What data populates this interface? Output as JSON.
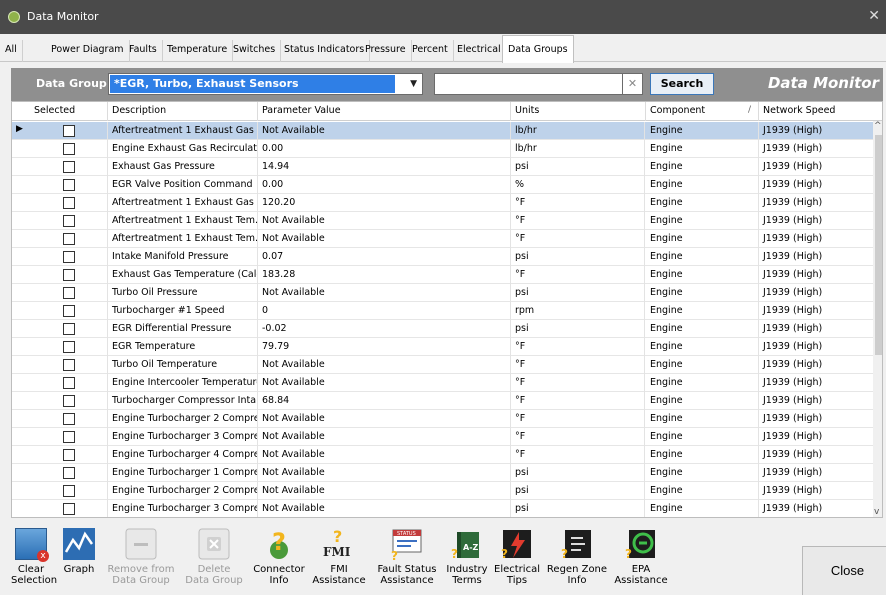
{
  "window": {
    "title": "Data Monitor",
    "close_glyph": "✕"
  },
  "tabs": [
    "All",
    "Power Diagram",
    "Faults",
    "Temperature",
    "Switches",
    "Status Indicators",
    "Pressure",
    "Percent",
    "Electrical",
    "Data Groups"
  ],
  "active_tab": "Data Groups",
  "filter": {
    "label": "Data Group",
    "selected": "*EGR, Turbo, Exhaust Sensors",
    "search_value": "",
    "clear_glyph": "✕",
    "search_label": "Search",
    "brand": "Data Monitor"
  },
  "grid": {
    "headers": [
      "Selected",
      "Description",
      "Parameter Value",
      "Units",
      "Component",
      "Network Speed"
    ],
    "sort_glyph": "/",
    "rows": [
      {
        "desc": "Aftertreatment 1 Exhaust Gas ...",
        "value": "Not Available",
        "units": "lb/hr",
        "comp": "Engine",
        "net": "J1939 (High)"
      },
      {
        "desc": "Engine Exhaust Gas Recirculati...",
        "value": "0.00",
        "units": "lb/hr",
        "comp": "Engine",
        "net": "J1939 (High)"
      },
      {
        "desc": "Exhaust Gas Pressure",
        "value": "14.94",
        "units": "psi",
        "comp": "Engine",
        "net": "J1939 (High)"
      },
      {
        "desc": "EGR Valve Position Command",
        "value": "0.00",
        "units": "%",
        "comp": "Engine",
        "net": "J1939 (High)"
      },
      {
        "desc": "Aftertreatment 1 Exhaust Gas ...",
        "value": "120.20",
        "units": "°F",
        "comp": "Engine",
        "net": "J1939 (High)"
      },
      {
        "desc": "Aftertreatment 1 Exhaust Tem...",
        "value": "Not Available",
        "units": "°F",
        "comp": "Engine",
        "net": "J1939 (High)"
      },
      {
        "desc": "Aftertreatment 1 Exhaust Tem...",
        "value": "Not Available",
        "units": "°F",
        "comp": "Engine",
        "net": "J1939 (High)"
      },
      {
        "desc": "Intake Manifold Pressure",
        "value": "0.07",
        "units": "psi",
        "comp": "Engine",
        "net": "J1939 (High)"
      },
      {
        "desc": "Exhaust Gas Temperature (Calc...",
        "value": "183.28",
        "units": "°F",
        "comp": "Engine",
        "net": "J1939 (High)"
      },
      {
        "desc": "Turbo Oil Pressure",
        "value": "Not Available",
        "units": "psi",
        "comp": "Engine",
        "net": "J1939 (High)"
      },
      {
        "desc": "Turbocharger #1 Speed",
        "value": "0",
        "units": "rpm",
        "comp": "Engine",
        "net": "J1939 (High)"
      },
      {
        "desc": "EGR Differential Pressure",
        "value": "-0.02",
        "units": "psi",
        "comp": "Engine",
        "net": "J1939 (High)"
      },
      {
        "desc": "EGR Temperature",
        "value": "79.79",
        "units": "°F",
        "comp": "Engine",
        "net": "J1939 (High)"
      },
      {
        "desc": "Turbo Oil Temperature",
        "value": "Not Available",
        "units": "°F",
        "comp": "Engine",
        "net": "J1939 (High)"
      },
      {
        "desc": "Engine Intercooler Temperature",
        "value": "Not Available",
        "units": "°F",
        "comp": "Engine",
        "net": "J1939 (High)"
      },
      {
        "desc": "Turbocharger Compressor Inta...",
        "value": "68.84",
        "units": "°F",
        "comp": "Engine",
        "net": "J1939 (High)"
      },
      {
        "desc": "Engine Turbocharger 2 Compre...",
        "value": "Not Available",
        "units": "°F",
        "comp": "Engine",
        "net": "J1939 (High)"
      },
      {
        "desc": "Engine Turbocharger 3 Compre...",
        "value": "Not Available",
        "units": "°F",
        "comp": "Engine",
        "net": "J1939 (High)"
      },
      {
        "desc": "Engine Turbocharger 4 Compre...",
        "value": "Not Available",
        "units": "°F",
        "comp": "Engine",
        "net": "J1939 (High)"
      },
      {
        "desc": "Engine Turbocharger 1 Compre...",
        "value": "Not Available",
        "units": "psi",
        "comp": "Engine",
        "net": "J1939 (High)"
      },
      {
        "desc": "Engine Turbocharger 2 Compre...",
        "value": "Not Available",
        "units": "psi",
        "comp": "Engine",
        "net": "J1939 (High)"
      },
      {
        "desc": "Engine Turbocharger 3 Compre...",
        "value": "Not Available",
        "units": "psi",
        "comp": "Engine",
        "net": "J1939 (High)"
      }
    ]
  },
  "toolbar": {
    "tools": [
      {
        "name": "clear-selection",
        "label1": "Clear",
        "label2": "Selection",
        "icon": "clear-selection-icon",
        "enabled": true
      },
      {
        "name": "graph",
        "label1": "Graph",
        "label2": "",
        "icon": "graph-icon",
        "enabled": true
      },
      {
        "name": "remove-from-data-group",
        "label1": "Remove from",
        "label2": "Data Group",
        "icon": "remove-icon",
        "enabled": false
      },
      {
        "name": "delete-data-group",
        "label1": "Delete",
        "label2": "Data Group",
        "icon": "delete-icon",
        "enabled": false
      },
      {
        "name": "connector-info",
        "label1": "Connector",
        "label2": "Info",
        "icon": "connector-info-icon",
        "enabled": true
      },
      {
        "name": "fmi-assistance",
        "label1": "FMI",
        "label2": "Assistance",
        "icon": "fmi-icon",
        "enabled": true
      },
      {
        "name": "fault-status-assistance",
        "label1": "Fault Status",
        "label2": "Assistance",
        "icon": "fault-status-icon",
        "enabled": true
      },
      {
        "name": "industry-terms",
        "label1": "Industry",
        "label2": "Terms",
        "icon": "industry-terms-icon",
        "enabled": true
      },
      {
        "name": "electrical-tips",
        "label1": "Electrical",
        "label2": "Tips",
        "icon": "electrical-tips-icon",
        "enabled": true
      },
      {
        "name": "regen-zone-info",
        "label1": "Regen Zone",
        "label2": "Info",
        "icon": "regen-zone-icon",
        "enabled": true
      },
      {
        "name": "epa-assistance",
        "label1": "EPA",
        "label2": "Assistance",
        "icon": "epa-icon",
        "enabled": true
      }
    ],
    "close_label": "Close",
    "icon_text": {
      "fmi": "FMI",
      "status": "STATUS",
      "az": "A-Z"
    }
  }
}
